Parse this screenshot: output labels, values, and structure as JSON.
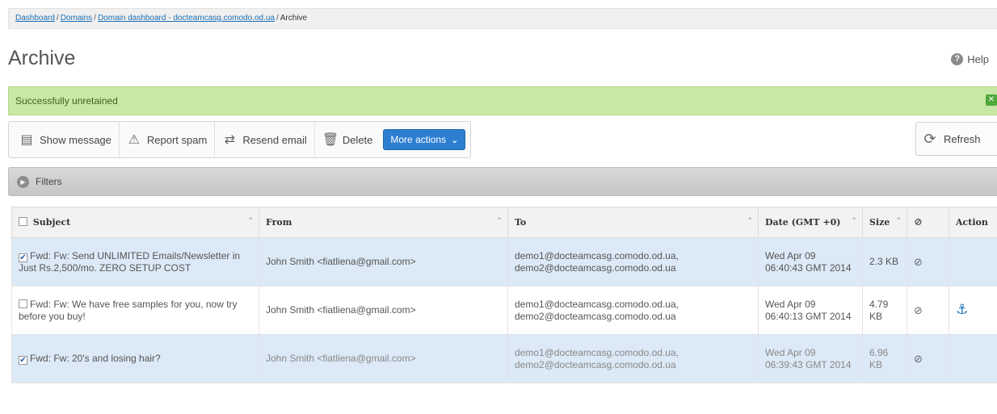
{
  "breadcrumb": {
    "items": [
      "Dashboard",
      "Domains",
      "Domain dashboard - docteamcasg.comodo.od.ua"
    ],
    "current": "Archive"
  },
  "page": {
    "title": "Archive",
    "help_label": "Help"
  },
  "alert": {
    "message": "Successfully unretained"
  },
  "toolbar": {
    "show_message": "Show message",
    "report_spam": "Report spam",
    "resend_email": "Resend email",
    "delete": "Delete",
    "more_actions": "More actions",
    "refresh": "Refresh"
  },
  "filters": {
    "label": "Filters"
  },
  "table": {
    "columns": [
      "Subject",
      "From",
      "To",
      "Date (GMT +0)",
      "Size",
      "Action"
    ],
    "rows": [
      {
        "checked": true,
        "subject": "Fwd: Fw: Send UNLIMITED Emails/Newsletter in Just Rs.2,500/mo. ZERO SETUP COST",
        "from": "John Smith <fiatliena@gmail.com>",
        "to1": "demo1@docteamcasg.comodo.od.ua,",
        "to2": "demo2@docteamcasg.comodo.od.ua",
        "date": "Wed Apr 09 06:40:43 GMT 2014",
        "size": "2.3 KB",
        "attachment": "paperclip-icon",
        "action": ""
      },
      {
        "checked": false,
        "subject": "Fwd: Fw: We have free samples for you, now try before you buy!",
        "from": "John Smith <fiatliena@gmail.com>",
        "to1": "demo1@docteamcasg.comodo.od.ua,",
        "to2": "demo2@docteamcasg.comodo.od.ua",
        "date": "Wed Apr 09 06:40:13 GMT 2014",
        "size": "4.79 KB",
        "attachment": "paperclip-icon",
        "action": "anchor-icon"
      },
      {
        "checked": true,
        "subject": "Fwd: Fw: 20's and losing hair?",
        "from": "John Smith <fiatliena@gmail.com>",
        "to1": "demo1@docteamcasg.comodo.od.ua,",
        "to2": "demo2@docteamcasg.comodo.od.ua",
        "date": "Wed Apr 09 06:39:43 GMT 2014",
        "size": "6.96 KB",
        "attachment": "paperclip-icon",
        "action": ""
      }
    ]
  },
  "colors": {
    "accent": "#2d7ed0",
    "success_bg": "#c9e8a6",
    "selected_row": "#dce9f6",
    "link": "#1a6fb5"
  }
}
